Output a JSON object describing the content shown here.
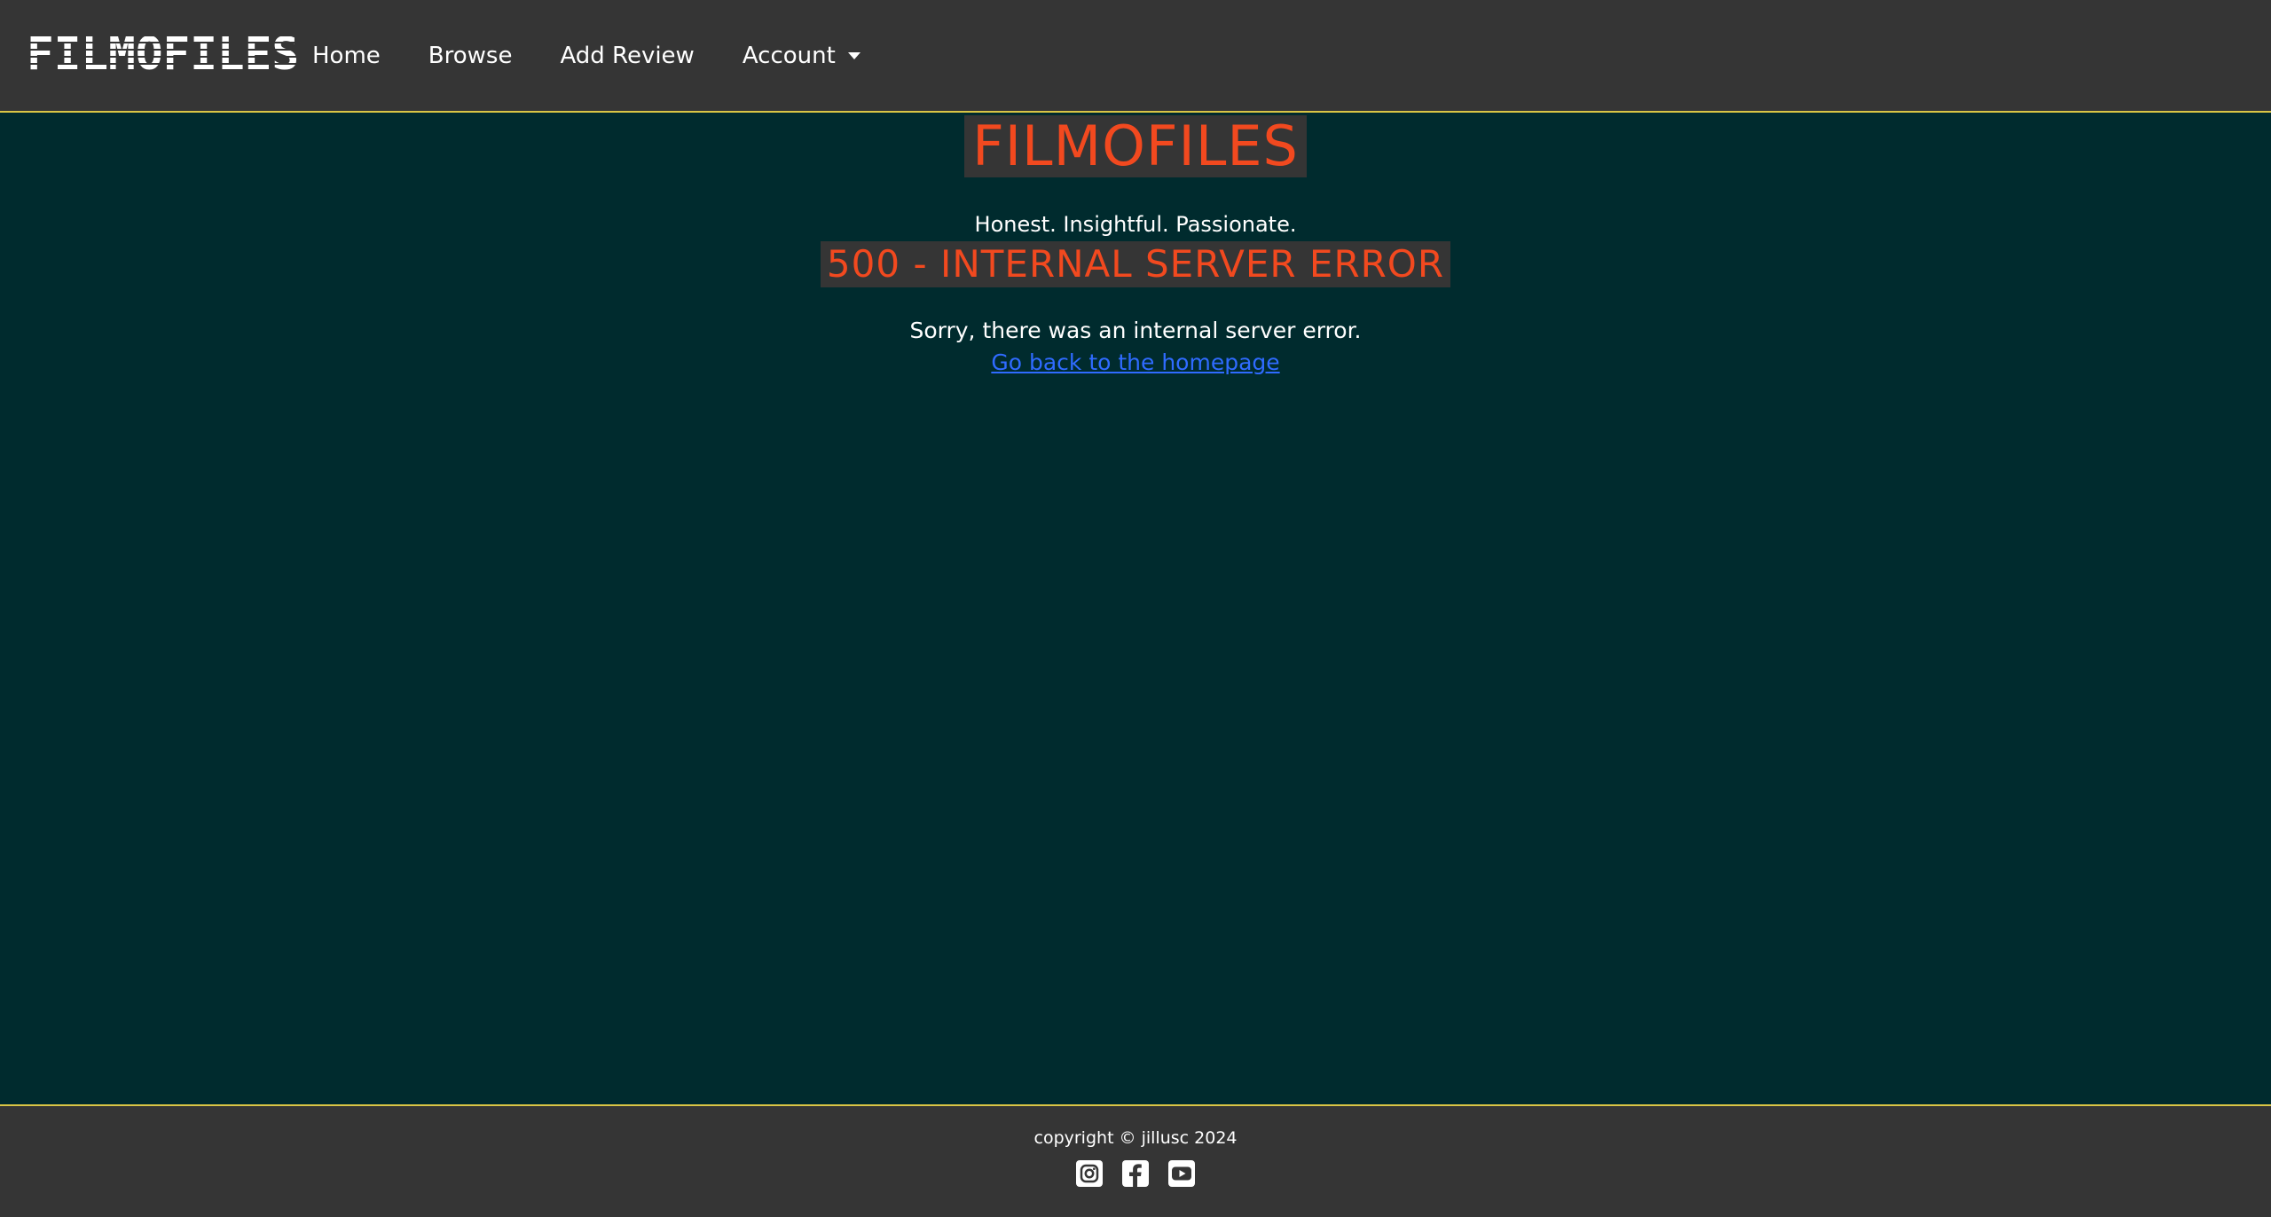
{
  "navbar": {
    "logo": "FILMOFILES",
    "links": [
      {
        "label": "Home"
      },
      {
        "label": "Browse"
      },
      {
        "label": "Add Review"
      }
    ],
    "account_label": "Account"
  },
  "main": {
    "site_title": "FILMOFILES",
    "tagline": "Honest. Insightful. Passionate.",
    "error_title": "500 - INTERNAL SERVER ERROR",
    "error_message": "Sorry, there was an internal server error.",
    "home_link": "Go back to the homepage"
  },
  "footer": {
    "copyright": "copyright © jillusc 2024",
    "socials": [
      "instagram-icon",
      "facebook-icon",
      "youtube-icon"
    ]
  },
  "colors": {
    "background": "#002b2e",
    "bar": "#353535",
    "accent_border": "#d9c545",
    "title": "#f2491f",
    "link": "#2f6bff"
  }
}
